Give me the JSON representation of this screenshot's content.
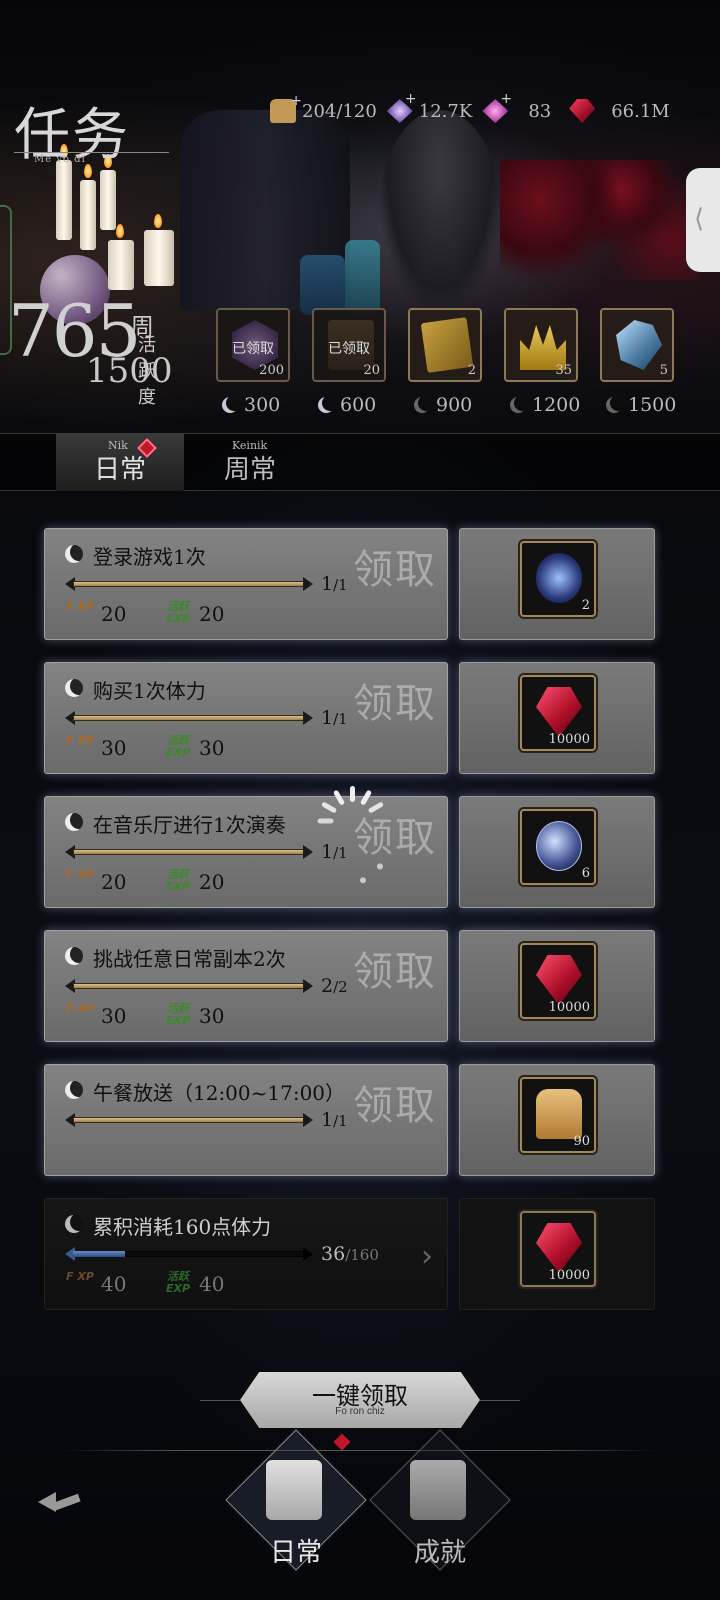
{
  "header": {
    "title_main": "任",
    "title_small": "务",
    "title_sub": "Me vo di"
  },
  "currencies": [
    {
      "icon": "bread-icon",
      "value": "204/120",
      "has_plus": true
    },
    {
      "icon": "purple-crystal-icon",
      "value": "12.7K",
      "has_plus": true
    },
    {
      "icon": "pink-gem-icon",
      "value": "83",
      "has_plus": true
    },
    {
      "icon": "ruby-icon",
      "value": "66.1M",
      "has_plus": false
    }
  ],
  "activity": {
    "current": "765",
    "label_week": "周",
    "label_activity": "活跃度",
    "max": "1500"
  },
  "milestones": [
    {
      "points": "300",
      "claimed": true,
      "claimed_text": "已领取",
      "count": "200",
      "icon": "purple-cube-icon"
    },
    {
      "points": "600",
      "claimed": true,
      "claimed_text": "已领取",
      "count": "20",
      "icon": "bread-box-icon"
    },
    {
      "points": "900",
      "claimed": false,
      "count": "2",
      "icon": "gold-book-icon"
    },
    {
      "points": "1200",
      "claimed": false,
      "count": "35",
      "icon": "gold-crown-icon"
    },
    {
      "points": "1500",
      "claimed": false,
      "count": "5",
      "icon": "blue-crystal-icon"
    }
  ],
  "tabs": {
    "daily": {
      "label": "日常",
      "small": "Nik"
    },
    "weekly": {
      "label": "周常",
      "small": "Keinik"
    }
  },
  "claim_watermark": "领取",
  "tasks": [
    {
      "name": "登录游戏1次",
      "progress": "1/1",
      "done": "1",
      "total": "/1",
      "xp": "20",
      "active_exp": "20",
      "reward_qty": "2",
      "reward_icon": "blue-bottle-icon",
      "completed": true
    },
    {
      "name": "购买1次体力",
      "progress": "1/1",
      "done": "1",
      "total": "/1",
      "xp": "30",
      "active_exp": "30",
      "reward_qty": "10000",
      "reward_icon": "ruby-icon",
      "completed": true
    },
    {
      "name": "在音乐厅进行1次演奏",
      "progress": "1/1",
      "done": "1",
      "total": "/1",
      "xp": "20",
      "active_exp": "20",
      "reward_qty": "6",
      "reward_icon": "orb-icon",
      "completed": true
    },
    {
      "name": "挑战任意日常副本2次",
      "progress": "2/2",
      "done": "2",
      "total": "/2",
      "xp": "30",
      "active_exp": "30",
      "reward_qty": "10000",
      "reward_icon": "ruby-icon",
      "completed": true
    },
    {
      "name": "午餐放送（12:00~17:00）",
      "progress": "1/1",
      "done": "1",
      "total": "/1",
      "xp": "",
      "active_exp": "",
      "reward_qty": "90",
      "reward_icon": "toast-icon",
      "completed": true
    },
    {
      "name": "累积消耗160点体力",
      "progress": "36/160",
      "done": "36",
      "total": "/160",
      "progress_fraction": 0.225,
      "xp": "40",
      "active_exp": "40",
      "reward_qty": "10000",
      "reward_icon": "ruby-icon",
      "completed": false
    }
  ],
  "xp_icon_labels": {
    "f": "F XP",
    "h": "活跃 EXP"
  },
  "claim_all": {
    "label": "一键领取",
    "sub": "Fo ron chiz"
  },
  "bottom_nav": {
    "daily": "日常",
    "achievements": "成就"
  }
}
